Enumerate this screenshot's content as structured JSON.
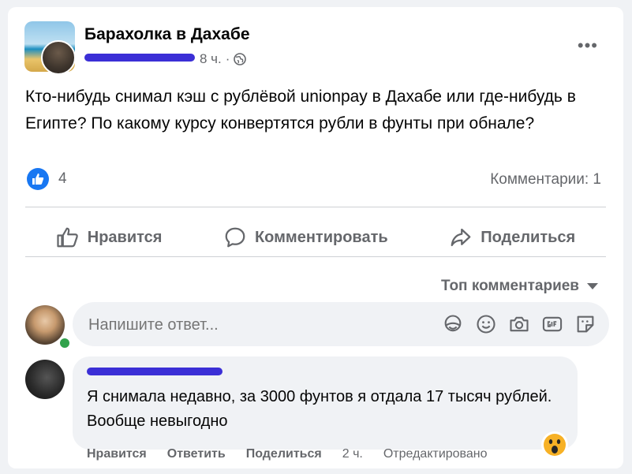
{
  "post": {
    "group_name": "Барахолка в Дахабе",
    "time": "8 ч.",
    "separator": "·",
    "more": "•••",
    "text": "Кто-нибудь снимал кэш с рублёвой unionpay в Дахабе или где-нибудь в Египте? По какому курсу конвертятся рубли в фунты при обнале?",
    "reactions_count": "4",
    "comments_count": "Комментарии: 1"
  },
  "actions": {
    "like": "Нравится",
    "comment": "Комментировать",
    "share": "Поделиться"
  },
  "comments_section": {
    "sort_label": "Топ комментариев",
    "reply_placeholder": "Напишите ответ..."
  },
  "comment": {
    "text": "Я снимала недавно, за 3000 фунтов я отдала 17 тысяч рублей. Вообще невыгодно",
    "like": "Нравится",
    "reply": "Ответить",
    "share": "Поделиться",
    "time": "2 ч.",
    "edited": "Отредактировано"
  },
  "colors": {
    "accent": "#1877f2",
    "secondary_text": "#65676b",
    "online": "#31a24c",
    "redaction": "#3b2fd6"
  }
}
